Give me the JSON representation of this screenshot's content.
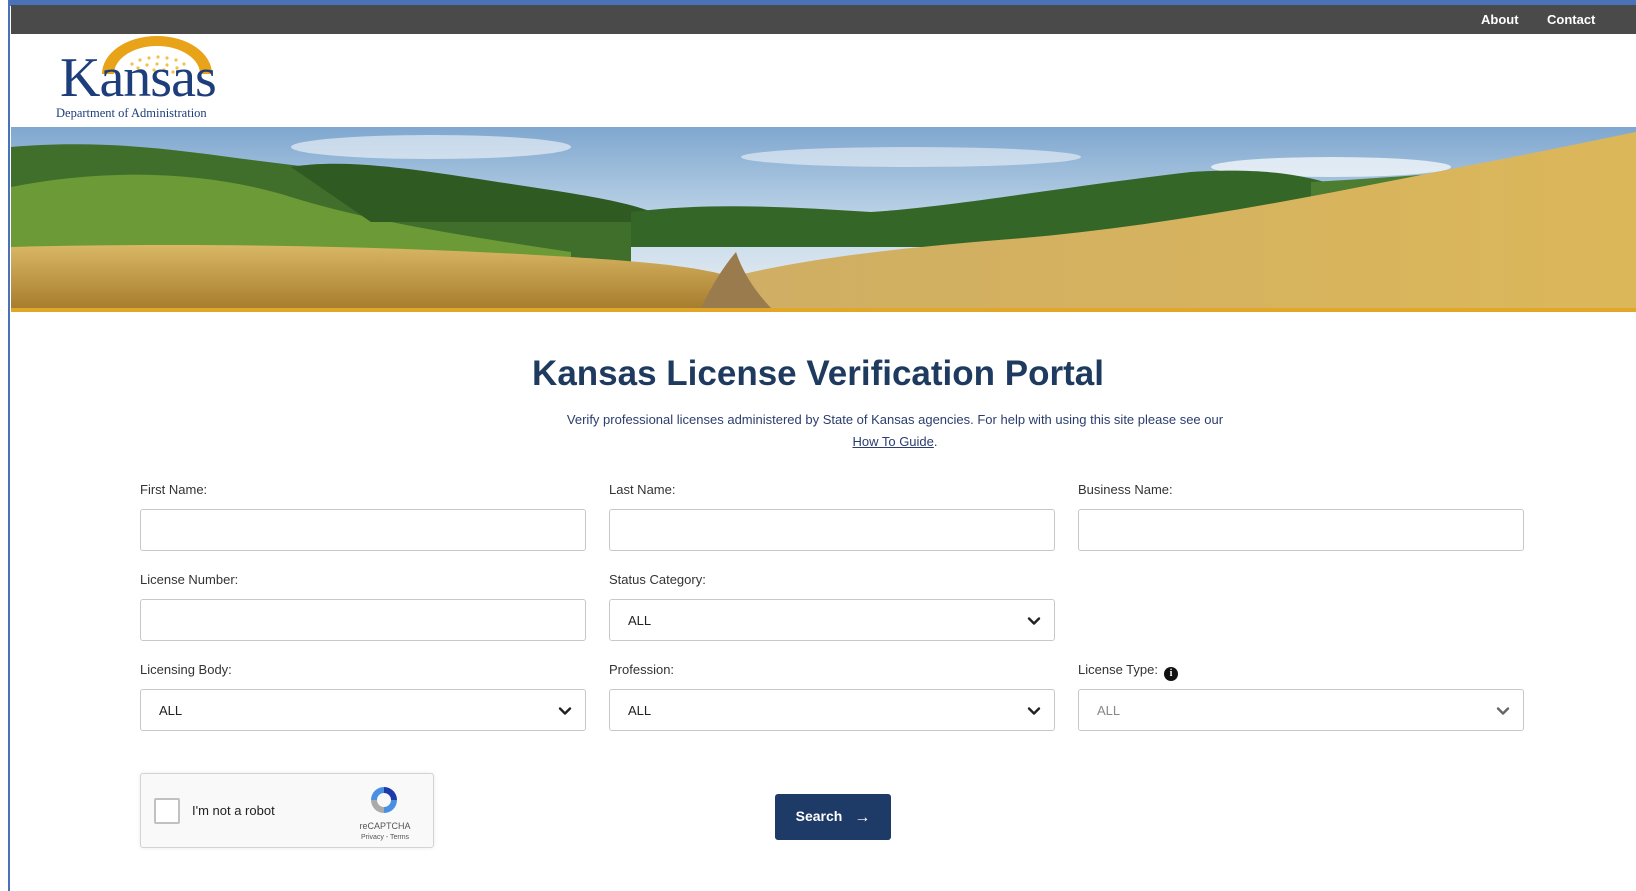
{
  "nav": {
    "about": "About",
    "contact": "Contact"
  },
  "logo": {
    "wordmark": "Kansas",
    "subtitle": "Department of Administration"
  },
  "page": {
    "title": "Kansas License Verification Portal",
    "description": "Verify professional licenses administered by State of Kansas agencies. For help with using this site please see our",
    "guide_link": "How To Guide",
    "guide_suffix": "."
  },
  "form": {
    "first_name": {
      "label": "First Name:",
      "value": ""
    },
    "last_name": {
      "label": "Last Name:",
      "value": ""
    },
    "business_name": {
      "label": "Business Name:",
      "value": ""
    },
    "license_number": {
      "label": "License Number:",
      "value": ""
    },
    "status_category": {
      "label": "Status Category:",
      "value": "ALL"
    },
    "licensing_body": {
      "label": "Licensing Body:",
      "value": "ALL"
    },
    "profession": {
      "label": "Profession:",
      "value": "ALL"
    },
    "license_type": {
      "label": "License Type:",
      "value": "ALL",
      "info_icon": "info-circle-icon"
    }
  },
  "captcha": {
    "label": "I'm not a robot",
    "brand": "reCAPTCHA",
    "terms": "Privacy - Terms"
  },
  "search_button": {
    "label": "Search",
    "icon": "arrow-right-icon"
  },
  "colors": {
    "topbar": "#4a4a4a",
    "brand": "#1d3e7b",
    "button": "#1e3a66",
    "accent": "#e2a629"
  }
}
